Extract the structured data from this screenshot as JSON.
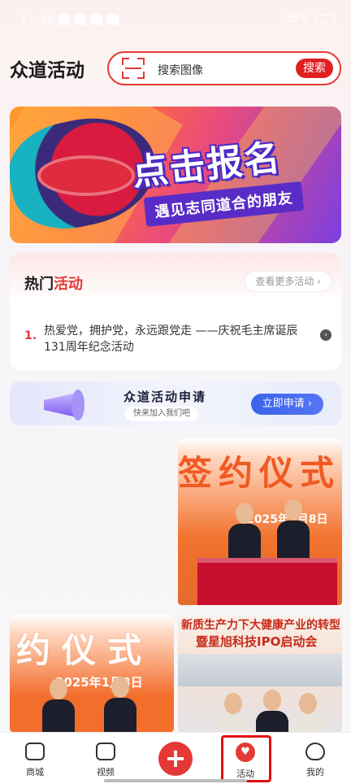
{
  "status_bar": {
    "time": "12:46",
    "battery": "35%"
  },
  "header": {
    "title": "众道活动"
  },
  "search": {
    "placeholder": "搜索图像",
    "button": "搜索"
  },
  "banner": {
    "title": "点击报名",
    "subtitle": "遇见志同道合的朋友"
  },
  "hot_section": {
    "title_black": "热门",
    "title_red": "活动",
    "more": "查看更多活动",
    "items": [
      {
        "index": "1.",
        "text": "热爱党，拥护党，永远跟党走 ——庆祝毛主席诞辰131周年纪念活动"
      }
    ]
  },
  "apply": {
    "title": "众道活动申请",
    "subtitle": "快来加入我们吧",
    "button": "立即申请"
  },
  "photos": {
    "photo1_text": "签约仪式",
    "photo1_date": "2025年1月8日",
    "photo2_text": "约仪式",
    "photo2_date": "2025年1月8日",
    "photo3_line1": "新质生产力下大健康产业的转型",
    "photo3_line2": "暨星旭科技IPO启动会"
  },
  "tabbar": {
    "items": [
      {
        "label": "商城",
        "icon": "bag-icon"
      },
      {
        "label": "视频",
        "icon": "video-icon"
      },
      {
        "label": "",
        "icon": "plus-icon"
      },
      {
        "label": "活动",
        "icon": "heart-icon"
      },
      {
        "label": "我的",
        "icon": "mascot-icon"
      }
    ]
  },
  "colors": {
    "accent": "#e53935",
    "apply_button": "#3a64e8"
  }
}
